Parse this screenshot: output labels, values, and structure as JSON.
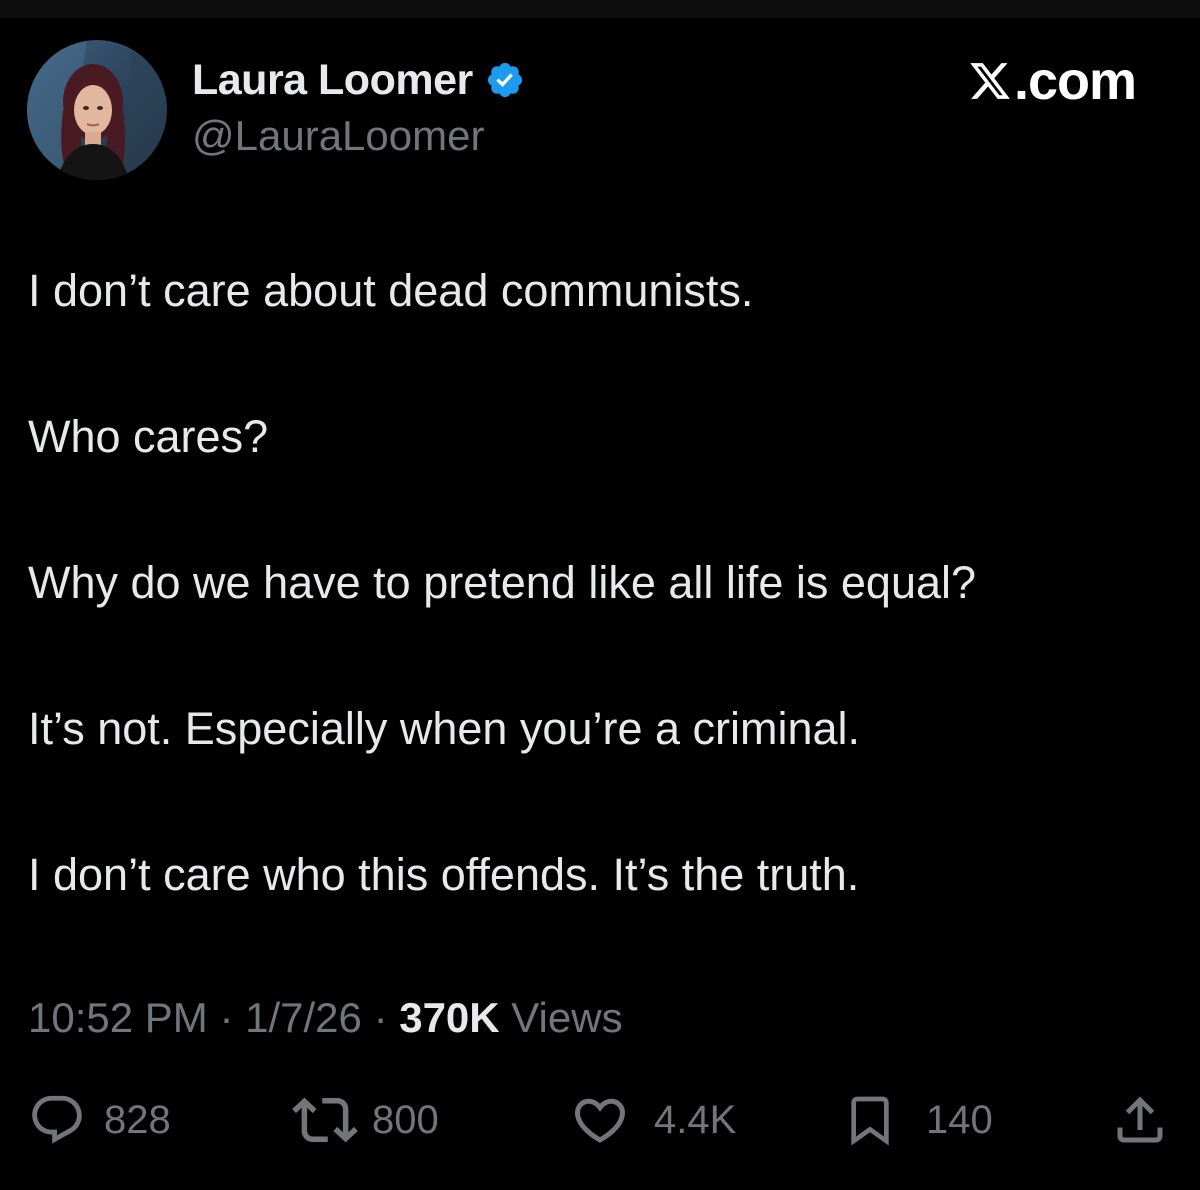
{
  "author": {
    "display_name": "Laura Loomer",
    "handle": "@LauraLoomer",
    "verified_icon": "verified-badge-icon",
    "verified_color": "#1d9bf0"
  },
  "brand": {
    "text": ".com",
    "logo_icon": "x-logo-icon"
  },
  "tweet": {
    "paragraphs": [
      "I don’t care about dead communists.",
      "Who cares?",
      "Why do we have to pretend like all life is equal?",
      "It’s not. Especially when you’re a criminal.",
      "I don’t care who this offends. It’s the truth."
    ],
    "time": "10:52 PM",
    "separator": "·",
    "date": "1/7/26",
    "views_count": "370K",
    "views_label": "Views"
  },
  "actions": {
    "reply": {
      "icon": "reply-bubble-icon",
      "count": "828"
    },
    "retweet": {
      "icon": "retweet-icon",
      "count": "800"
    },
    "like": {
      "icon": "heart-icon",
      "count": "4.4K"
    },
    "bookmark": {
      "icon": "bookmark-icon",
      "count": "140"
    },
    "share": {
      "icon": "share-icon"
    }
  },
  "colors": {
    "background": "#000000",
    "primary_text": "#e7e9ea",
    "secondary_text": "#71767b",
    "accent": "#1d9bf0"
  }
}
